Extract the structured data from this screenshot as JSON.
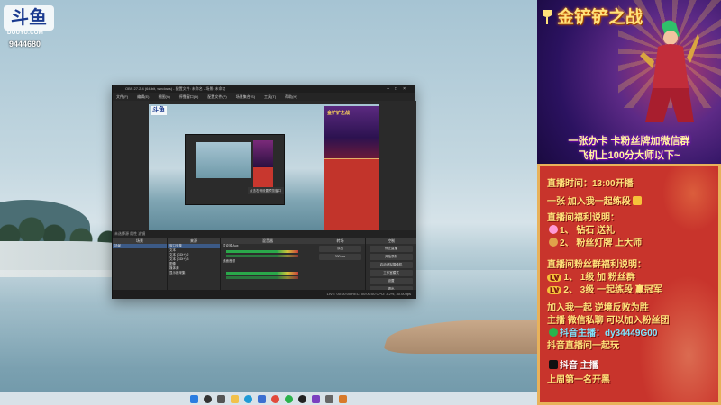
{
  "watermark": {
    "site_logo": "斗鱼",
    "site_domain": "DOUYU.COM",
    "room_id": "9444680"
  },
  "obs": {
    "title": "OBS 27.2.4 (64-bit, windows) - 配置文件: 未命名 - 场景: 未命名",
    "menu": [
      "文件(F)",
      "编辑(E)",
      "视图(V)",
      "停靠窗口(D)",
      "配置文件(P)",
      "场景集合(S)",
      "工具(T)",
      "帮助(H)"
    ],
    "preview_tooltip": "点击右侧设置预览窗口",
    "statusline": "未选择源  属性  滤镜",
    "docks": {
      "scenes_title": "场景",
      "sources_title": "来源",
      "mixer_title": "混音器",
      "transitions_title": "转场",
      "controls_title": "控制",
      "scene_item": "场景",
      "sources": [
        "窗口采集",
        "文本",
        "文本 (GDI+) 2",
        "文本 (GDI+) 3",
        "图像",
        "媒体源",
        "显示器采集"
      ],
      "mixer_channels": [
        "麦克风/Aux",
        "桌面音频"
      ],
      "transition_value": "淡出",
      "transition_duration": "300 ms",
      "controls": [
        "停止直播",
        "开始录制",
        "启动虚拟摄像机",
        "工作室模式",
        "设置",
        "退出"
      ]
    },
    "footer": "LIVE: 00:00:00   REC: 00:00:00   CPU: 3.2%, 30.00 fps"
  },
  "poster": {
    "title": "金铲铲之战",
    "line1": "一张办卡 卡粉丝牌加微信群",
    "line2": "飞机上100分大师以下~"
  },
  "panel": {
    "lines": [
      "直播时间：13:00开播",
      "一张 加入我一起练段",
      "直播间福利说明：",
      "1、 钻石 送礼",
      "2、 粉丝灯牌 上大师",
      "直播间粉丝群福利说明：",
      "1、 1级 加 粉丝群",
      "2、 3级 一起练段 赢冠军",
      "加入我一起 逆境反败为胜",
      "主播 微信私聊 可以加入粉丝团",
      "抖音主播：dy34449G00",
      "抖音直播间一起玩",
      "抖音 主播",
      "上周第一名开黑"
    ]
  },
  "taskbar": {
    "icons": [
      "start-icon",
      "search-icon",
      "task-view-icon",
      "file-explorer-icon",
      "edge-icon",
      "store-icon",
      "chrome-icon",
      "wechat-icon",
      "obs-icon",
      "game-icon",
      "settings-icon",
      "app-icon"
    ]
  },
  "colors": {
    "panel_red": "#c8342c",
    "panel_gold": "#e8b25a",
    "obs_dark": "#2b2b2b",
    "poster_purple": "#5d2a86"
  }
}
